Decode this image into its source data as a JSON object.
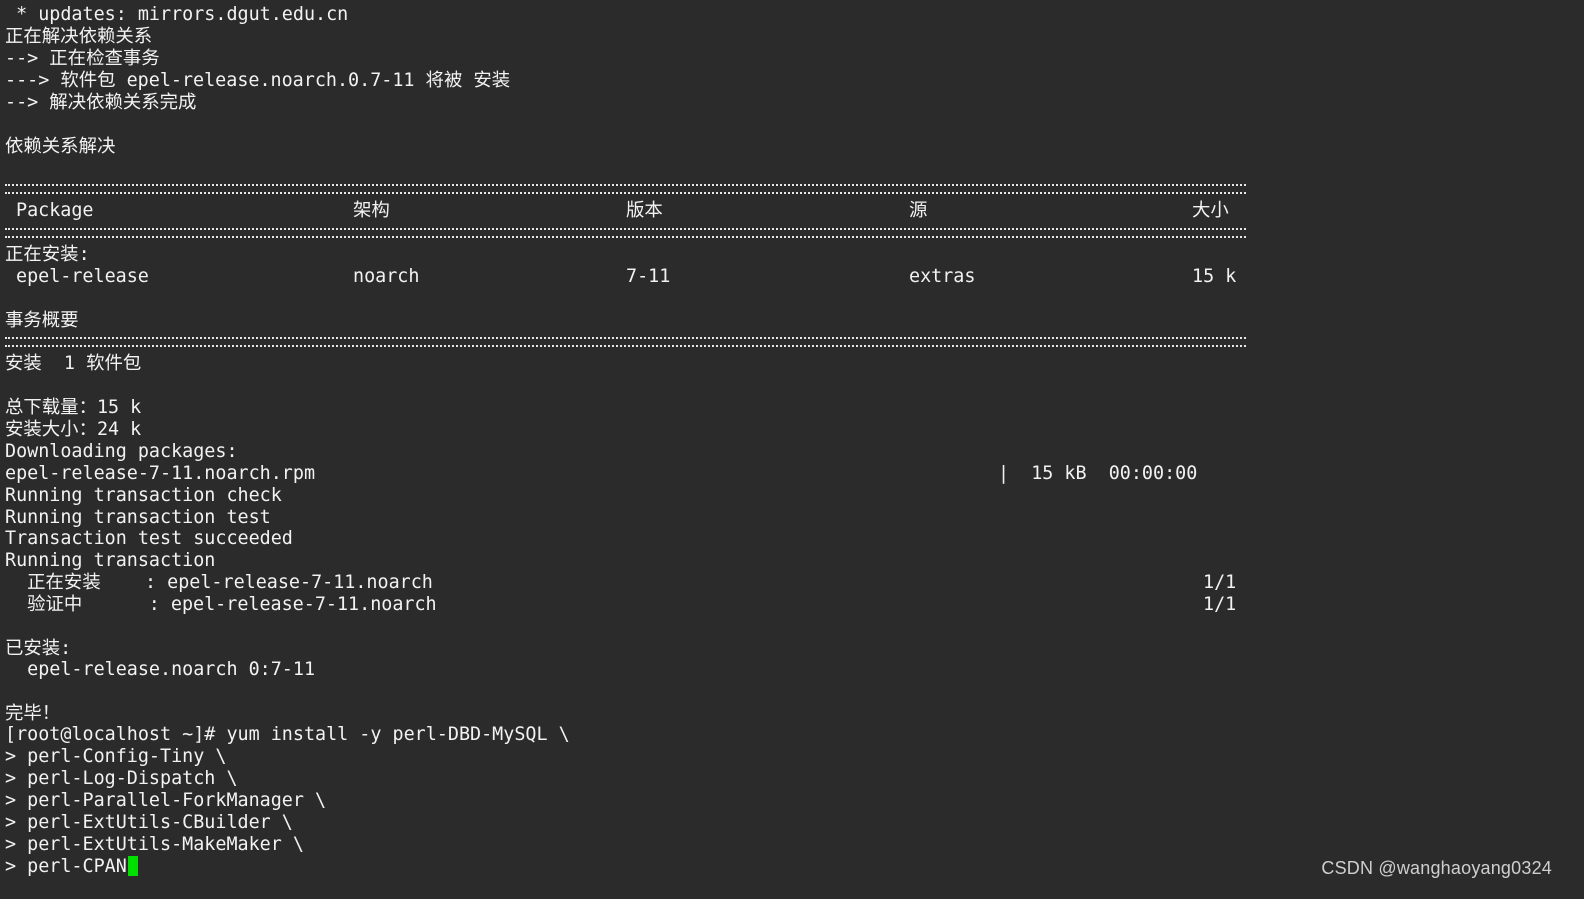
{
  "colors": {
    "background": "#2b2b2b",
    "text": "#f2f2f2",
    "cursor": "#00e000",
    "watermark": "#cfcfcf"
  },
  "terminal": {
    "header_lines": [
      " * updates: mirrors.dgut.edu.cn",
      "正在解决依赖关系",
      "--> 正在检查事务",
      "---> 软件包 epel-release.noarch.0.7-11 将被 安装",
      "--> 解决依赖关系完成"
    ],
    "resolved_title": "依赖关系解决",
    "table": {
      "headers": {
        "package": "Package",
        "arch": "架构",
        "version": "版本",
        "repo": "源",
        "size": "大小"
      },
      "section_label": "正在安装:",
      "row": {
        "package": "epel-release",
        "arch": "noarch",
        "version": "7-11",
        "repo": "extras",
        "size": "15 k"
      }
    },
    "summary_title": "事务概要",
    "install_count_line": "安装  1 软件包",
    "total_download": "总下载量：15 k",
    "install_size": "安装大小：24 k",
    "downloading": "Downloading packages:",
    "download_row": {
      "file": "epel-release-7-11.noarch.rpm",
      "stats": "|  15 kB  00:00:00"
    },
    "run_lines": [
      "Running transaction check",
      "Running transaction test",
      "Transaction test succeeded",
      "Running transaction"
    ],
    "steps": [
      {
        "action": "  正在安装    : epel-release-7-11.noarch",
        "progress": "1/1"
      },
      {
        "action": "  验证中      : epel-release-7-11.noarch",
        "progress": "1/1"
      }
    ],
    "installed_title": "已安装:",
    "installed_pkg": "  epel-release.noarch 0:7-11",
    "done": "完毕！",
    "command_lines": [
      "[root@localhost ~]# yum install -y perl-DBD-MySQL \\",
      "> perl-Config-Tiny \\",
      "> perl-Log-Dispatch \\",
      "> perl-Parallel-ForkManager \\",
      "> perl-ExtUtils-CBuilder \\",
      "> perl-ExtUtils-MakeMaker \\",
      "> perl-CPAN"
    ]
  },
  "watermark": "CSDN @wanghaoyang0324"
}
